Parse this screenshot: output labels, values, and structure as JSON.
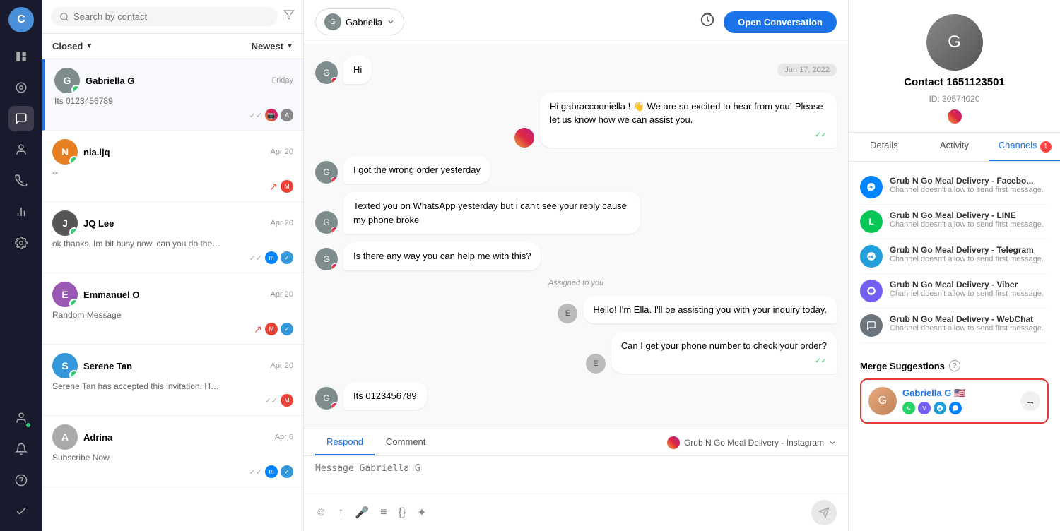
{
  "nav": {
    "avatar_letter": "C",
    "icons": [
      "≡",
      "◎",
      "💬",
      "👤",
      "📡",
      "📊",
      "⚙",
      "👤",
      "🔔",
      "?",
      "✓"
    ]
  },
  "sidebar": {
    "search_placeholder": "Search by contact",
    "filter_label": "Closed",
    "sort_label": "Newest",
    "conversations": [
      {
        "id": 1,
        "name": "Gabriella G",
        "time": "Friday",
        "preview": "Its 0123456789",
        "avatar_color": "#888",
        "active": true,
        "channels": [
          "instagram",
          "agent"
        ]
      },
      {
        "id": 2,
        "name": "nia.ljq",
        "time": "Apr 20",
        "preview": "--",
        "avatar_color": "#e67e22",
        "active": false,
        "channels": [
          "gmail"
        ]
      },
      {
        "id": 3,
        "name": "JQ Lee",
        "time": "Apr 20",
        "preview": "ok thanks. Im bit busy now, can you do the simple sign up for me...",
        "avatar_color": "#555",
        "active": false,
        "channels": [
          "messenger",
          "check"
        ]
      },
      {
        "id": 4,
        "name": "Emmanuel O",
        "time": "Apr 20",
        "preview": "Random Message",
        "avatar_color": "#9b59b6",
        "active": false,
        "channels": [
          "gmail",
          "check"
        ]
      },
      {
        "id": 5,
        "name": "Serene Tan",
        "time": "Apr 20",
        "preview": "Serene Tan has accepted this invitation. HOW TO GET WHATSAPP...",
        "avatar_color": "#3498db",
        "active": false,
        "channels": [
          "gmail"
        ]
      },
      {
        "id": 6,
        "name": "Adrina",
        "time": "Apr 6",
        "preview": "Subscribe Now",
        "avatar_color": "#aaa",
        "active": false,
        "channels": [
          "messenger",
          "check"
        ]
      }
    ]
  },
  "chat": {
    "agent_name": "Gabriella",
    "open_btn": "Open Conversation",
    "date_divider": "Jun 17, 2022",
    "messages": [
      {
        "id": 1,
        "side": "left",
        "text": "Hi",
        "type": "user"
      },
      {
        "id": 2,
        "side": "right",
        "text": "Hi gabraccooniella ! 👋 We are so excited to hear from you! Please let us know how we can assist you.",
        "type": "agent"
      },
      {
        "id": 3,
        "side": "left",
        "text": "I got the wrong order yesterday",
        "type": "user"
      },
      {
        "id": 4,
        "side": "left",
        "text": "Texted you on WhatsApp yesterday but i can't see your reply cause my phone broke",
        "type": "user"
      },
      {
        "id": 5,
        "side": "left",
        "text": "Is there any way you can help me with this?",
        "type": "user"
      },
      {
        "id": 6,
        "side": "system",
        "text": "Assigned to you",
        "type": "system"
      },
      {
        "id": 7,
        "side": "right",
        "text": "Hello! I'm Ella. I'll be assisting you with your inquiry today.",
        "type": "agent"
      },
      {
        "id": 8,
        "side": "right",
        "text": "Can I get your phone number to check your order?",
        "type": "agent"
      },
      {
        "id": 9,
        "side": "left",
        "text": "Its 0123456789",
        "type": "user"
      }
    ],
    "footer": {
      "tabs": [
        "Respond",
        "Comment"
      ],
      "active_tab": "Respond",
      "channel": "Grub N Go Meal Delivery - Instagram",
      "placeholder": "Message Gabriella G"
    }
  },
  "right_panel": {
    "contact_name": "Contact 1651123501",
    "contact_id": "ID: 30574020",
    "tabs": [
      "Details",
      "Activity",
      "Channels"
    ],
    "active_tab": "Channels",
    "channels_badge": 1,
    "channels": [
      {
        "name": "Grub N Go Meal Delivery - Facebo...",
        "note": "Channel doesn't allow to send first message.",
        "type": "messenger"
      },
      {
        "name": "Grub N Go Meal Delivery - LINE",
        "note": "Channel doesn't allow to send first message.",
        "type": "line"
      },
      {
        "name": "Grub N Go Meal Delivery - Telegram",
        "note": "Channel doesn't allow to send first message.",
        "type": "telegram"
      },
      {
        "name": "Grub N Go Meal Delivery - Viber",
        "note": "Channel doesn't allow to send first message.",
        "type": "viber"
      },
      {
        "name": "Grub N Go Meal Delivery - WebChat",
        "note": "Channel doesn't allow to send first message.",
        "type": "webchat"
      }
    ],
    "merge_suggestions": {
      "title": "Merge Suggestions",
      "contact": {
        "name": "Gabriella G 🇺🇸",
        "channels": [
          "whatsapp",
          "viber",
          "telegram",
          "messenger"
        ]
      }
    }
  }
}
